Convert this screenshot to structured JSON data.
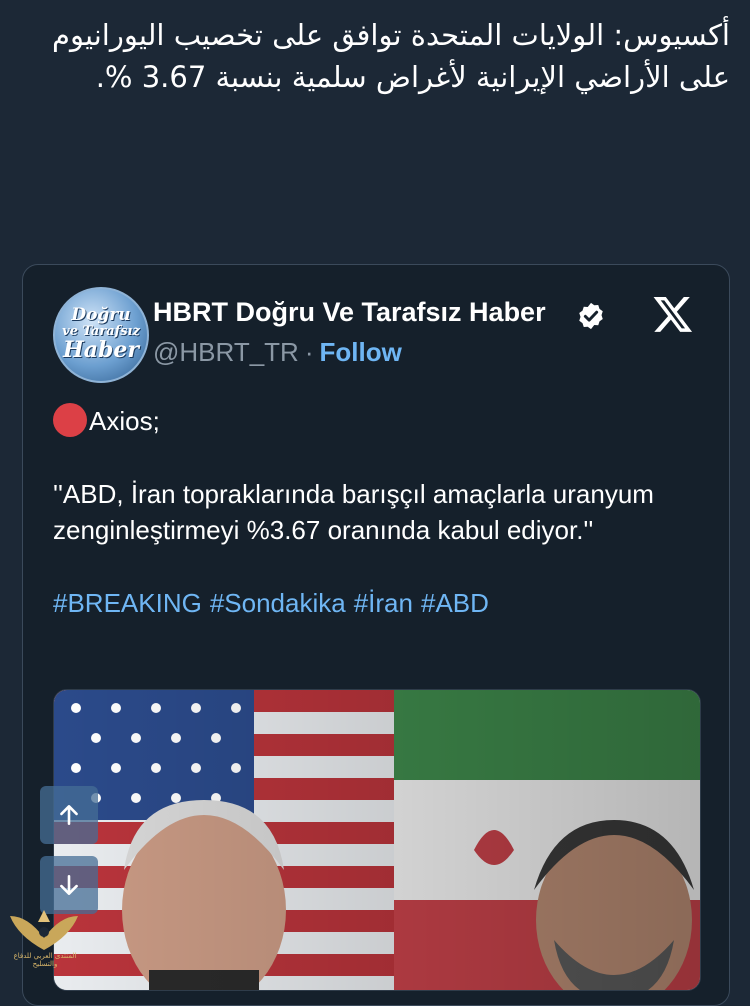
{
  "tweet": {
    "text": "أكسيوس: الولايات المتحدة توافق على تخصيب اليورانيوم على الأراضي الإيرانية لأغراض سلمية بنسبة 3.67 %."
  },
  "quoted": {
    "avatar_text": [
      "Doğru",
      "ve Tarafsız",
      "Haber"
    ],
    "author_name": "HBRT Doğru Ve Tarafsız Haber",
    "handle": "@HBRT_TR",
    "separator": "·",
    "follow_label": "Follow",
    "source_line": "Axios;",
    "body": "''ABD, İran topraklarında barışçıl amaçlarla uranyum zenginleştirmeyi %3.67 oranında kabul ediyor.''",
    "hashtags": [
      "#BREAKING",
      "#Sondakika",
      "#İran",
      "#ABD"
    ]
  },
  "scroll_buttons": {
    "up_icon": "arrow-up-icon",
    "down_icon": "arrow-down-icon"
  },
  "watermark": {
    "text": "المنتدى العربي للدفاع والتسليح"
  },
  "colors": {
    "background": "#1c2836",
    "card": "#15202b",
    "link": "#6fb6f4",
    "muted": "#8b98a5",
    "red_dot": "#dc4046"
  }
}
